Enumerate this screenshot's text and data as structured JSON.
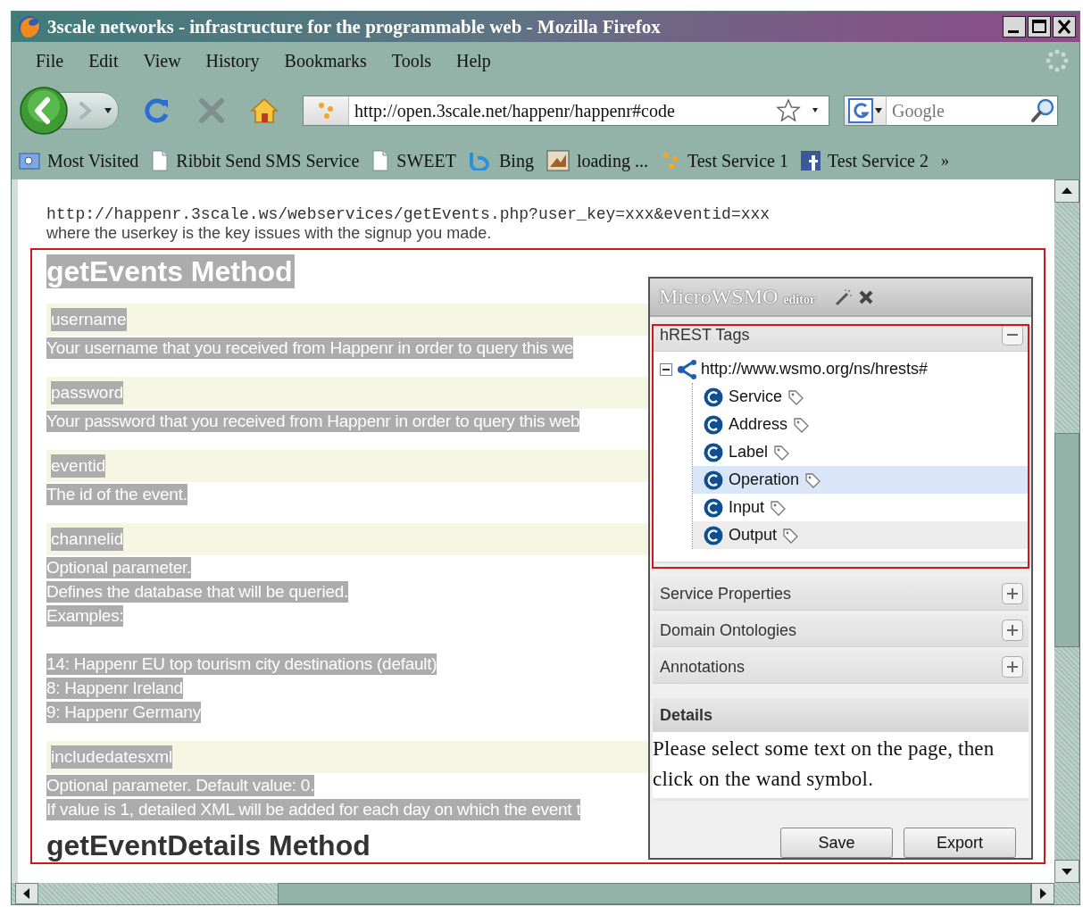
{
  "window": {
    "title": "3scale networks - infrastructure for the programmable web - Mozilla Firefox"
  },
  "menu": [
    "File",
    "Edit",
    "View",
    "History",
    "Bookmarks",
    "Tools",
    "Help"
  ],
  "navbar": {
    "url": "http://open.3scale.net/happenr/happenr#code",
    "search_placeholder": "Google"
  },
  "bookmarks": [
    {
      "label": "Most Visited",
      "kind": "folder"
    },
    {
      "label": "Ribbit Send SMS Service",
      "kind": "page"
    },
    {
      "label": "SWEET",
      "kind": "page"
    },
    {
      "label": "Bing",
      "kind": "bing"
    },
    {
      "label": "loading ...",
      "kind": "image"
    },
    {
      "label": "Test Service 1",
      "kind": "dots"
    },
    {
      "label": "Test Service 2",
      "kind": "square"
    }
  ],
  "bookmarks_more": "»",
  "page": {
    "code_line": "http://happenr.3scale.ws/webservices/getEvents.php?user_key=xxx&eventid=xxx",
    "intro": "where the userkey is the key issues with the signup you made.",
    "heading": "getEvents Method",
    "params": [
      {
        "name": "username",
        "lines": [
          "Your username that you received from Happenr in order to query this we"
        ]
      },
      {
        "name": "password",
        "lines": [
          "Your password that you received from Happenr in order to query this web"
        ]
      },
      {
        "name": "eventid",
        "lines": [
          "The id of the event."
        ]
      },
      {
        "name": "channelid",
        "lines": [
          "Optional parameter.",
          "Defines the database that will be queried.",
          "Examples:"
        ],
        "examples": [
          "14: Happenr EU top tourism city destinations (default)",
          "8: Happenr Ireland",
          "9: Happenr Germany"
        ]
      },
      {
        "name": "includedatesxml",
        "lines": [
          "Optional parameter. Default value: 0.",
          "If value is 1, detailed XML will be added for each day on which the event t"
        ]
      }
    ],
    "next_heading": "getEventDetails Method"
  },
  "panel": {
    "title": "MicroWSMO",
    "subtitle": "editor",
    "sections": [
      {
        "title": "hREST Tags",
        "expanded": true,
        "tree": {
          "label": "http://www.wsmo.org/ns/hrests#",
          "expanded": true,
          "children": [
            {
              "label": "Service",
              "selected": false,
              "hovered": false
            },
            {
              "label": "Address",
              "selected": false,
              "hovered": false
            },
            {
              "label": "Label",
              "selected": false,
              "hovered": false
            },
            {
              "label": "Operation",
              "selected": true,
              "hovered": false
            },
            {
              "label": "Input",
              "selected": false,
              "hovered": false
            },
            {
              "label": "Output",
              "selected": false,
              "hovered": true
            }
          ]
        }
      },
      {
        "title": "Service Properties",
        "expanded": false
      },
      {
        "title": "Domain Ontologies",
        "expanded": false
      },
      {
        "title": "Annotations",
        "expanded": false
      }
    ],
    "details": {
      "title": "Details",
      "text": "Please select some text on the page, then click on the wand symbol."
    },
    "buttons": [
      "Save",
      "Export"
    ]
  }
}
